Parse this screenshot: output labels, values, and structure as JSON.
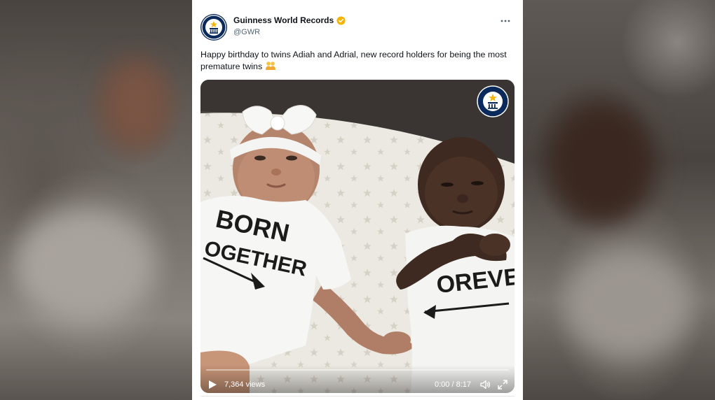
{
  "tweet": {
    "display_name": "Guinness World Records",
    "handle": "@GWR",
    "text": "Happy birthday to twins Adiah and Adrial, new record holders for being the most premature twins",
    "emoji": "twins-emoji",
    "verified_color": "#f4b400"
  },
  "video": {
    "views": "7,364 views",
    "time": "0:00 / 8:17",
    "progress": 0,
    "accent": "#1d9bf0"
  },
  "onesie_left": {
    "line1": "BORN",
    "line2": "OGETHER"
  },
  "onesie_right": {
    "line1": "OREVER"
  },
  "icons": {
    "avatar": "gwr-logo-icon",
    "verified": "verified-badge-icon",
    "more": "more-options-icon",
    "play": "play-icon",
    "volume": "volume-icon",
    "fullscreen": "fullscreen-icon",
    "watermark": "gwr-watermark-icon"
  }
}
